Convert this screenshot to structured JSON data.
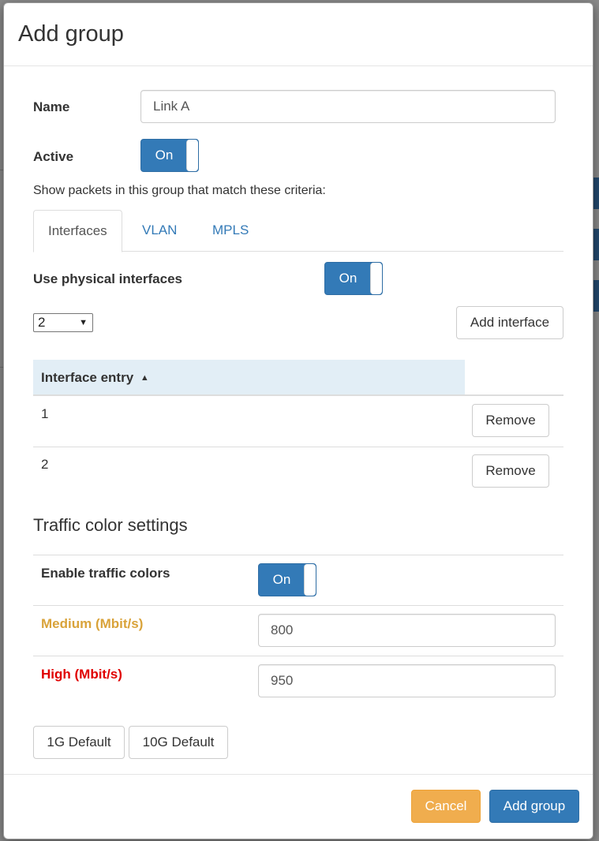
{
  "dialog": {
    "title": "Add group"
  },
  "form": {
    "name_label": "Name",
    "name_value": "Link A",
    "active_label": "Active",
    "active_toggle": "On",
    "criteria_text": "Show packets in this group that match these criteria:"
  },
  "tabs": [
    {
      "label": "Interfaces",
      "active": true
    },
    {
      "label": "VLAN",
      "active": false
    },
    {
      "label": "MPLS",
      "active": false
    }
  ],
  "interfaces": {
    "use_physical_label": "Use physical interfaces",
    "use_physical_toggle": "On",
    "select_value": "2",
    "add_button": "Add interface",
    "table_header": "Interface entry",
    "sort_indicator": "▲",
    "rows": [
      {
        "entry": "1",
        "action": "Remove"
      },
      {
        "entry": "2",
        "action": "Remove"
      }
    ]
  },
  "traffic": {
    "section_title": "Traffic color settings",
    "enable_label": "Enable traffic colors",
    "enable_toggle": "On",
    "medium_label": "Medium (Mbit/s)",
    "medium_value": "800",
    "high_label": "High (Mbit/s)",
    "high_value": "950",
    "preset_1g": "1G Default",
    "preset_10g": "10G Default"
  },
  "footer": {
    "cancel": "Cancel",
    "submit": "Add group"
  },
  "colors": {
    "primary": "#337ab7",
    "warning": "#f0ad4e",
    "medium": "#d9a33a",
    "high": "#e00000",
    "table_header_bg": "#e2eef6"
  }
}
